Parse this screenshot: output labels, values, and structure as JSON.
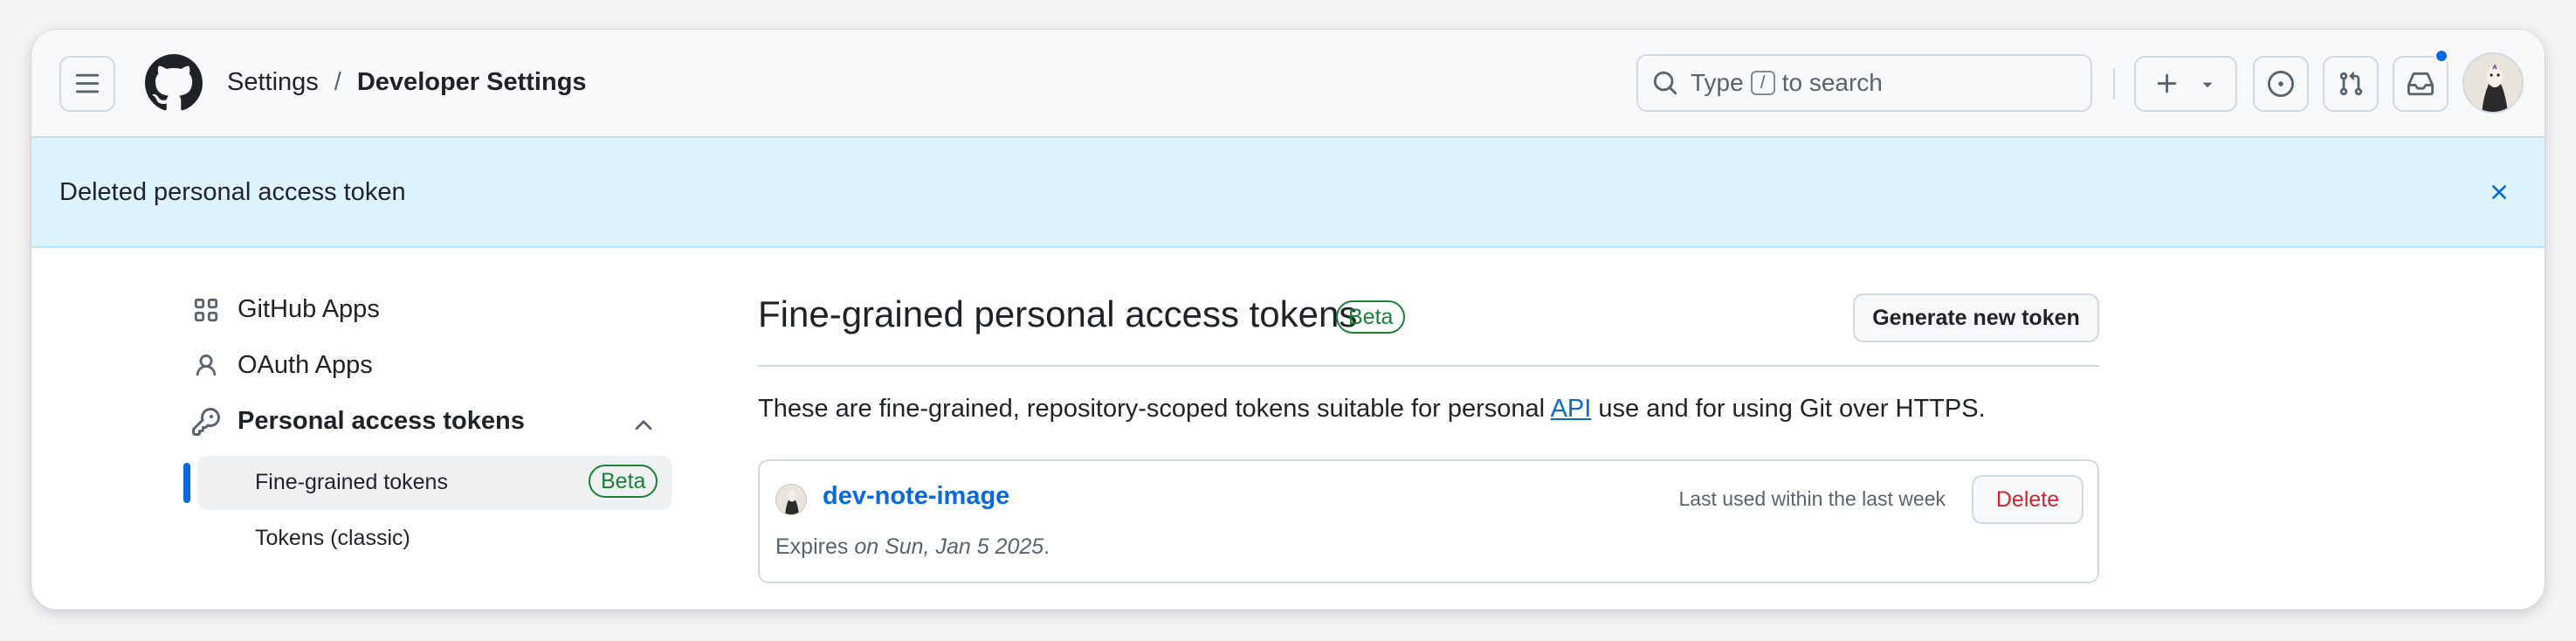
{
  "header": {
    "breadcrumb": {
      "parent": "Settings",
      "separator": "/",
      "current": "Developer Settings"
    },
    "search": {
      "prefix": "Type",
      "key": "/",
      "suffix": "to search"
    }
  },
  "flash": {
    "message": "Deleted personal access token"
  },
  "sidebar": {
    "items": [
      {
        "label": "GitHub Apps",
        "icon": "apps-grid-icon"
      },
      {
        "label": "OAuth Apps",
        "icon": "person-icon"
      },
      {
        "label": "Personal access tokens",
        "icon": "key-icon"
      }
    ],
    "subitems": [
      {
        "label": "Fine-grained tokens",
        "badge": "Beta",
        "active": true
      },
      {
        "label": "Tokens (classic)"
      }
    ]
  },
  "main": {
    "title": "Fine-grained personal access tokens",
    "badge": "Beta",
    "generate_button": "Generate new token",
    "description": {
      "before": "These are fine-grained, repository-scoped tokens suitable for personal ",
      "link": "API",
      "after": " use and for using Git over HTTPS."
    },
    "tokens": [
      {
        "name": "dev-note-image",
        "last_used": "Last used within the last week",
        "delete_label": "Delete",
        "expires_prefix": "Expires ",
        "expires_date": "on Sun, Jan 5 2025",
        "expires_suffix": "."
      }
    ]
  },
  "colors": {
    "accent": "#0969da",
    "success": "#1a7f37",
    "danger": "#d1242f",
    "flash_bg": "#ddf4ff"
  }
}
